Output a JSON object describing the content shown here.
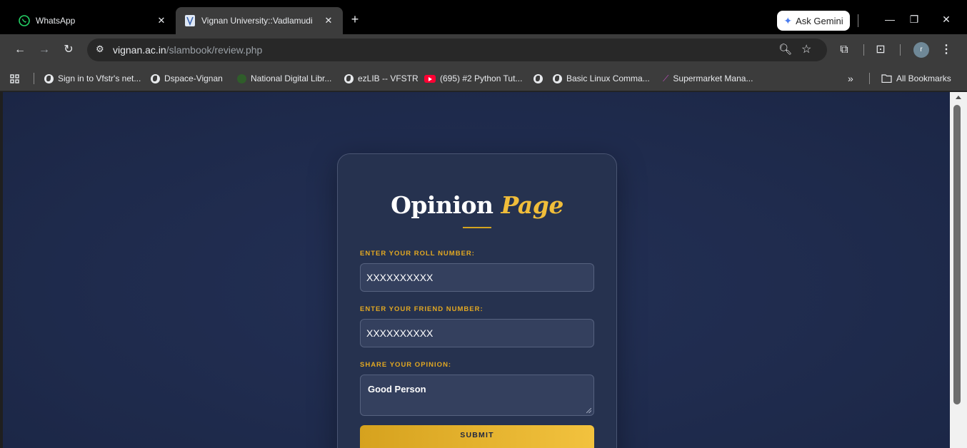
{
  "browser": {
    "tabs": [
      {
        "title": "WhatsApp",
        "icon": "whatsapp-icon"
      },
      {
        "title": "Vignan University::Vadlamudi",
        "icon": "vignan-favicon"
      }
    ],
    "gemini_label": "Ask Gemini",
    "url_host": "vignan.ac.in",
    "url_path": "/slambook/review.php",
    "profile_initial": "r",
    "bookmarks": [
      {
        "label": "Sign in to Vfstr's net..."
      },
      {
        "label": "Dspace-Vignan"
      },
      {
        "label": "National Digital Libr..."
      },
      {
        "label": "ezLIB -- VFSTR"
      },
      {
        "label": "(695) #2 Python Tut..."
      },
      {
        "label": "Basic Linux Comma..."
      },
      {
        "label": "Supermarket Mana..."
      }
    ],
    "all_bookmarks_label": "All Bookmarks"
  },
  "form": {
    "title_main": "Opinion",
    "title_accent": "Page",
    "roll_label": "ENTER YOUR ROLL NUMBER:",
    "roll_value": "XXXXXXXXXX",
    "friend_label": "ENTER YOUR FRIEND NUMBER:",
    "friend_value": "XXXXXXXXXX",
    "opinion_label": "SHARE YOUR OPINION:",
    "opinion_value": "Good Person",
    "submit_label": "SUBMIT"
  },
  "colors": {
    "page_bg": "#1f2b4d",
    "card_bg": "#26324f",
    "accent_gold": "#f0bd3a",
    "label_gold": "#e2a822"
  }
}
